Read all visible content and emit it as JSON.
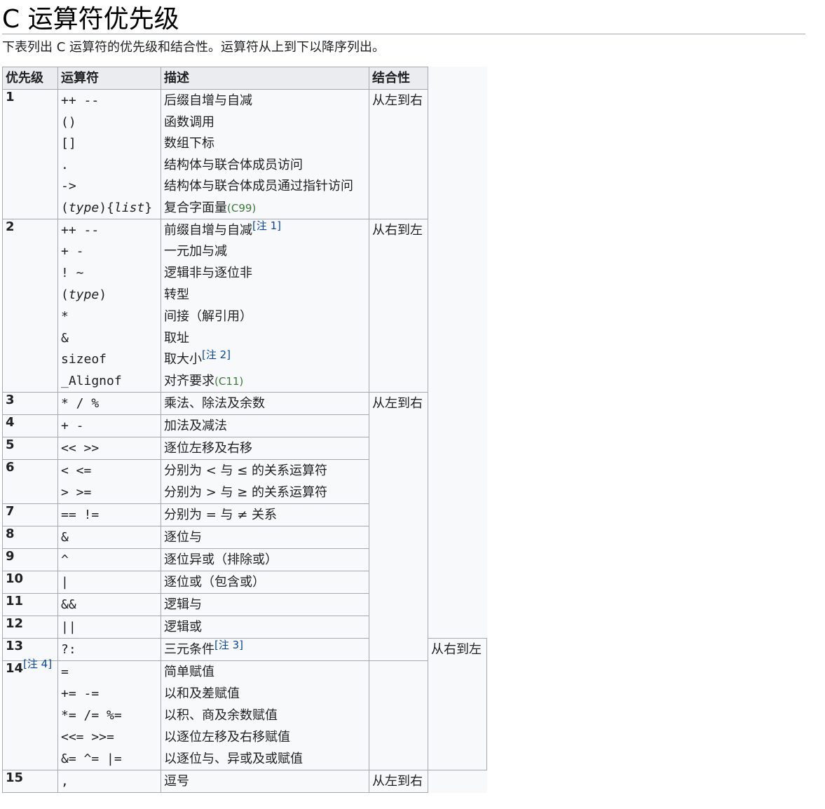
{
  "title": "C 运算符优先级",
  "intro": "下表列出 C 运算符的优先级和结合性。运算符从上到下以降序列出。",
  "headers": {
    "level": "优先级",
    "operator": "运算符",
    "description": "描述",
    "associativity": "结合性"
  },
  "assoc": {
    "ltr": "从左到右",
    "rtl": "从右到左"
  },
  "notes": {
    "n1": "[注 1]",
    "n2": "[注 2]",
    "n3": "[注 3]",
    "n4": "[注 4]"
  },
  "std": {
    "c99": "(C99)",
    "c11": "(C11)"
  },
  "levels": {
    "l1": {
      "level": "1",
      "ops": [
        "++ --",
        "()",
        "[]",
        ".",
        "->"
      ],
      "op6a": "(",
      "op6b": "type",
      "op6c": "){",
      "op6d": "list",
      "op6e": "}",
      "descs": [
        "后缀自增与自减",
        "函数调用",
        "数组下标",
        "结构体与联合体成员访问",
        "结构体与联合体成员通过指针访问",
        "复合字面量"
      ]
    },
    "l2": {
      "level": "2",
      "ops": [
        "++ --",
        "+ -",
        "! ~",
        "",
        "*",
        "&",
        "sizeof",
        "_Alignof"
      ],
      "op4a": "(",
      "op4b": "type",
      "op4c": ")",
      "descs": [
        "前缀自增与自减",
        "一元加与减",
        "逻辑非与逐位非",
        "转型",
        "间接（解引用）",
        "取址",
        "取大小",
        "对齐要求"
      ]
    },
    "l3": {
      "level": "3",
      "op": "* / %",
      "desc": "乘法、除法及余数"
    },
    "l4": {
      "level": "4",
      "op": "+ -",
      "desc": "加法及减法"
    },
    "l5": {
      "level": "5",
      "op": "<< >>",
      "desc": "逐位左移及右移"
    },
    "l6": {
      "level": "6",
      "ops": [
        "< <=",
        "> >="
      ],
      "descs": [
        "分别为 < 与 ≤ 的关系运算符",
        "分别为 > 与 ≥ 的关系运算符"
      ]
    },
    "l7": {
      "level": "7",
      "op": "== !=",
      "desc": "分别为 = 与 ≠ 关系"
    },
    "l8": {
      "level": "8",
      "op": "&",
      "desc": "逐位与"
    },
    "l9": {
      "level": "9",
      "op": "^",
      "desc": "逐位异或（排除或）"
    },
    "l10": {
      "level": "10",
      "op": "|",
      "desc": "逐位或（包含或）"
    },
    "l11": {
      "level": "11",
      "op": "&&",
      "desc": "逻辑与"
    },
    "l12": {
      "level": "12",
      "op": "||",
      "desc": "逻辑或"
    },
    "l13": {
      "level": "13",
      "op": "?:",
      "desc": "三元条件"
    },
    "l14": {
      "level": "14",
      "ops": [
        "=",
        "+= -=",
        "*= /= %=",
        "<<= >>=",
        "&= ^= |="
      ],
      "descs": [
        "简单赋值",
        "以和及差赋值",
        "以积、商及余数赋值",
        "以逐位左移及右移赋值",
        "以逐位与、异或及或赋值"
      ]
    },
    "l15": {
      "level": "15",
      "op": ",",
      "desc": "逗号"
    }
  }
}
